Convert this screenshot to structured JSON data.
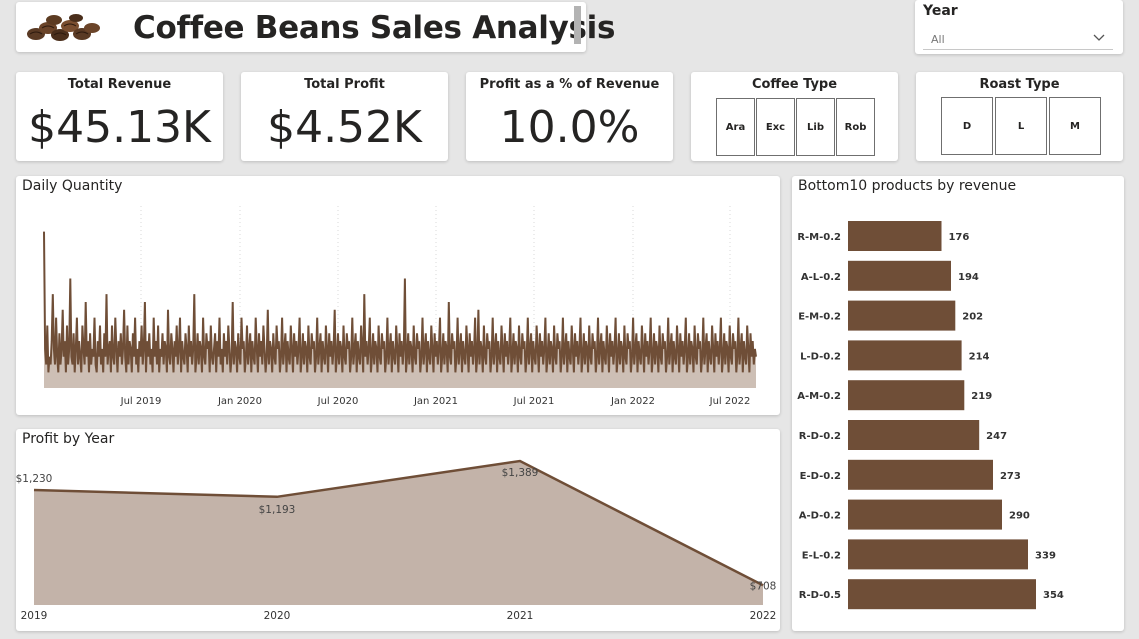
{
  "header": {
    "title": "Coffee Beans Sales Analysis",
    "logo_icon": "coffee-beans-image"
  },
  "year_slicer": {
    "label": "Year",
    "selected": "All"
  },
  "kpis": {
    "revenue": {
      "label": "Total Revenue",
      "value": "$45.13K"
    },
    "profit": {
      "label": "Total Profit",
      "value": "$4.52K"
    },
    "margin": {
      "label": "Profit as a % of Revenue",
      "value": "10.0%"
    }
  },
  "coffee_type": {
    "title": "Coffee Type",
    "options": [
      "Ara",
      "Exc",
      "Lib",
      "Rob"
    ]
  },
  "roast_type": {
    "title": "Roast Type",
    "options": [
      "D",
      "L",
      "M"
    ]
  },
  "colors": {
    "brown": "#6f4e37",
    "area_fill": "#c3b3a9",
    "daily_fill": "#cdbfb5"
  },
  "daily": {
    "title": "Daily Quantity",
    "ticks": [
      "Jul 2019",
      "Jan 2020",
      "Jul 2020",
      "Jan 2021",
      "Jul 2021",
      "Jan 2022",
      "Jul 2022"
    ]
  },
  "profit_year": {
    "title": "Profit by Year",
    "labels": [
      "$1,230",
      "$1,193",
      "$1,389",
      "$708"
    ]
  },
  "bottom10": {
    "title": "Bottom10 products by revenue"
  },
  "chart_data": [
    {
      "type": "area",
      "title": "Daily Quantity",
      "x_ticks": [
        "Jul 2019",
        "Jan 2020",
        "Jul 2020",
        "Jan 2021",
        "Jul 2021",
        "Jan 2022",
        "Jul 2022"
      ],
      "series": [
        {
          "values": [
            20,
            5,
            3,
            8,
            2,
            4,
            3,
            6,
            12,
            5,
            3,
            9,
            4,
            2,
            7,
            3,
            5,
            10,
            4,
            6,
            2,
            8,
            3,
            5,
            14,
            4,
            3,
            7,
            2,
            5,
            9,
            3,
            6,
            4,
            2,
            8,
            5,
            3,
            11,
            4,
            6,
            2,
            7,
            3,
            5,
            4,
            9,
            3,
            2,
            6,
            4,
            8,
            3,
            5,
            2,
            7,
            4,
            12,
            3,
            5,
            6,
            2,
            8,
            4,
            3,
            9,
            5,
            2,
            6,
            4,
            7,
            3,
            5,
            10,
            4,
            2,
            8,
            3,
            6,
            5,
            2,
            7,
            4,
            9,
            3,
            5,
            2,
            6,
            4,
            8,
            3,
            5,
            11,
            2,
            6,
            4,
            7,
            3,
            5,
            2,
            9,
            4,
            6,
            3,
            8,
            2,
            5,
            4,
            7,
            3,
            6,
            5,
            2,
            10,
            4,
            3,
            7,
            5,
            2,
            6,
            4,
            8,
            3,
            5,
            9,
            2,
            6,
            4,
            3,
            7,
            5,
            2,
            8,
            4,
            6,
            3,
            5,
            12,
            2,
            4,
            7,
            3,
            6,
            5,
            2,
            9,
            4,
            3,
            7,
            5,
            6,
            2,
            8,
            4,
            3,
            5,
            7,
            2,
            6,
            4,
            9,
            3,
            5,
            2,
            7,
            4,
            6,
            3,
            8,
            5,
            2,
            4,
            11,
            3,
            6,
            5,
            2,
            7,
            4,
            3,
            9,
            5,
            6,
            2,
            4,
            8,
            3,
            5,
            7,
            2,
            6,
            4,
            3,
            9,
            5,
            2,
            7,
            4,
            6,
            3,
            8,
            5,
            2,
            4,
            10,
            3,
            6,
            5,
            2,
            7,
            4,
            3,
            8,
            5,
            6,
            2,
            4,
            9,
            3,
            5,
            7,
            2,
            6,
            4,
            3,
            8,
            5,
            2,
            7,
            4,
            6,
            3,
            5,
            9,
            2,
            4,
            7,
            3,
            6,
            5,
            2,
            8,
            4,
            3,
            7,
            5,
            6,
            2,
            4,
            9,
            3,
            5,
            7,
            2,
            6,
            4,
            3,
            8,
            5,
            2,
            7,
            4,
            6,
            3,
            5,
            10,
            2,
            4,
            7,
            3,
            6,
            5,
            2,
            8,
            4,
            3,
            7,
            5,
            6,
            2,
            4,
            9,
            3,
            5,
            7,
            2,
            6,
            4,
            3,
            8,
            5,
            2,
            12,
            4,
            6,
            3,
            5,
            9,
            2,
            4,
            7,
            3,
            6,
            5,
            2,
            8,
            4,
            3,
            7,
            5,
            6,
            2,
            4,
            9,
            3,
            5,
            7,
            2,
            6,
            4,
            3,
            8,
            5,
            2,
            7,
            4,
            6,
            3,
            5,
            14,
            2,
            4,
            7,
            3,
            6,
            5,
            2,
            8,
            4,
            3,
            7,
            5,
            6,
            2,
            4,
            9,
            3,
            5,
            7,
            2,
            6,
            4,
            3,
            8,
            5,
            2,
            7,
            4,
            6,
            3,
            5,
            9,
            2,
            4,
            7,
            3,
            6,
            5,
            2,
            11,
            4,
            3,
            7,
            5,
            6,
            2,
            4,
            9,
            3,
            5,
            7,
            2,
            6,
            4,
            3,
            8,
            5,
            2,
            7,
            4,
            6,
            3,
            5,
            9,
            2,
            4,
            10,
            3,
            6,
            5,
            2,
            8,
            4,
            3,
            7,
            5,
            6,
            2,
            4,
            9,
            3,
            5,
            7,
            2,
            6,
            4,
            3,
            8,
            5,
            2,
            7,
            4,
            6,
            3,
            5,
            9,
            2,
            4,
            7,
            3,
            6,
            5,
            2,
            8,
            4,
            3,
            7,
            5,
            6,
            2,
            4,
            9,
            3,
            5,
            7,
            2,
            6,
            4,
            3,
            8,
            5,
            2,
            7,
            4,
            6,
            3,
            5,
            9,
            2,
            4,
            7,
            3,
            6,
            5,
            2,
            8,
            4,
            3,
            7,
            5,
            6,
            2,
            4,
            9,
            3,
            5,
            7,
            2,
            6,
            4,
            3,
            8,
            5,
            2,
            7,
            4,
            6,
            3,
            5,
            9,
            2,
            4,
            7,
            3,
            6,
            5,
            2,
            8,
            4,
            3,
            7,
            5,
            6,
            2,
            4,
            9,
            3,
            5,
            7,
            2,
            6,
            4,
            3,
            8,
            5,
            2,
            7,
            4,
            6,
            3,
            5,
            9,
            2,
            4,
            7,
            3,
            6,
            5,
            2,
            8,
            4,
            3,
            7,
            5,
            6,
            2,
            4,
            9,
            3,
            5,
            7,
            2,
            6,
            4,
            3,
            8,
            5,
            2,
            7,
            4,
            6,
            3,
            5,
            9,
            2,
            4,
            7,
            3,
            6,
            5,
            2,
            8,
            4,
            3,
            7,
            5,
            6,
            2,
            4,
            9,
            3,
            5,
            7,
            2,
            6,
            4,
            3,
            8,
            5,
            2,
            7,
            4,
            6,
            3,
            5,
            9,
            2,
            4,
            7,
            3,
            6,
            5,
            2,
            8,
            4,
            3,
            7,
            5,
            6,
            2,
            4,
            9,
            3,
            5,
            7,
            2,
            6,
            4,
            3,
            8,
            5,
            2,
            7,
            4,
            6,
            3,
            5,
            9,
            2,
            4,
            7,
            3,
            6,
            5,
            2,
            8,
            4,
            3,
            7,
            5,
            6,
            2,
            4,
            9,
            3,
            5,
            7,
            2,
            6,
            4,
            3,
            8,
            5,
            2,
            7,
            4,
            6,
            3,
            5,
            4
          ]
        }
      ],
      "grid": true
    },
    {
      "type": "area",
      "title": "Profit by Year",
      "categories": [
        "2019",
        "2020",
        "2021",
        "2022"
      ],
      "values": [
        1230,
        1193,
        1389,
        708
      ],
      "data_labels": [
        "$1,230",
        "$1,193",
        "$1,389",
        "$708"
      ]
    },
    {
      "type": "bar",
      "orientation": "horizontal",
      "title": "Bottom10 products by revenue",
      "categories": [
        "R-M-0.2",
        "A-L-0.2",
        "E-M-0.2",
        "L-D-0.2",
        "A-M-0.2",
        "R-D-0.2",
        "E-D-0.2",
        "A-D-0.2",
        "E-L-0.2",
        "R-D-0.5"
      ],
      "values": [
        176,
        194,
        202,
        214,
        219,
        247,
        273,
        290,
        339,
        354
      ]
    }
  ]
}
